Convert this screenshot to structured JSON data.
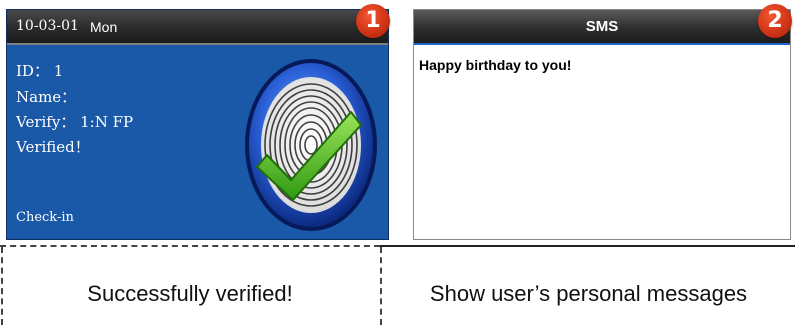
{
  "screen1": {
    "date": "10-03-01",
    "day": "Mon",
    "id_line": "ID： 1",
    "name_line": "Name：",
    "verify_line": "Verify： 1:N FP",
    "verified_line": "Verified！",
    "status": "Check-in",
    "icon": "fingerprint-check-icon"
  },
  "screen2": {
    "title": "SMS",
    "message": "Happy birthday to you!"
  },
  "badges": [
    "1",
    "2"
  ],
  "captions": {
    "left": "Successfully verified!",
    "right": "Show user’s personal messages"
  },
  "colors": {
    "screen1_bg": "#1a58a8",
    "header_bg": "#2a2a2a",
    "badge_red": "#d83a1a",
    "check_green": "#5cc62a"
  }
}
